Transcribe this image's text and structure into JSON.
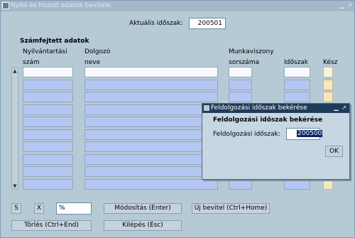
{
  "window": {
    "title": "Nyitó és hozott adatok bevitele"
  },
  "period": {
    "label": "Aktuális időszak:",
    "value": "200501"
  },
  "section": {
    "title": "Számfejtett adatok"
  },
  "columns": {
    "nyilv_line1": "Nyilvántartási",
    "nyilv_line2": "szám",
    "dolgozo_line1": "Dolgozó",
    "dolgozo_line2": "neve",
    "munka_line1": "Munkaviszony",
    "munka_line2": "sorszáma",
    "idoszak": "Időszak",
    "kesz": "Kész"
  },
  "filter": {
    "s_label": "S",
    "x_label": "X",
    "value": "%"
  },
  "buttons": {
    "modositas": "Módosítás (Enter)",
    "uj_bevitel": "Új bevitel (Ctrl+Home)",
    "torles": "Törlés (Ctrl+End)",
    "kilepes": "Kilépés (Esc)"
  },
  "dialog": {
    "title": "Feldolgozási időszak bekérése",
    "heading": "Feldolgozási időszak bekérése",
    "label": "Feldolgozási időszak:",
    "value": "200500",
    "ok": "OK"
  },
  "colors": {
    "field_blue": "#b4c6f2",
    "panel": "#b5cad5",
    "kesz": "#f5e6bf",
    "dialog_title": "#1f3b5a"
  }
}
